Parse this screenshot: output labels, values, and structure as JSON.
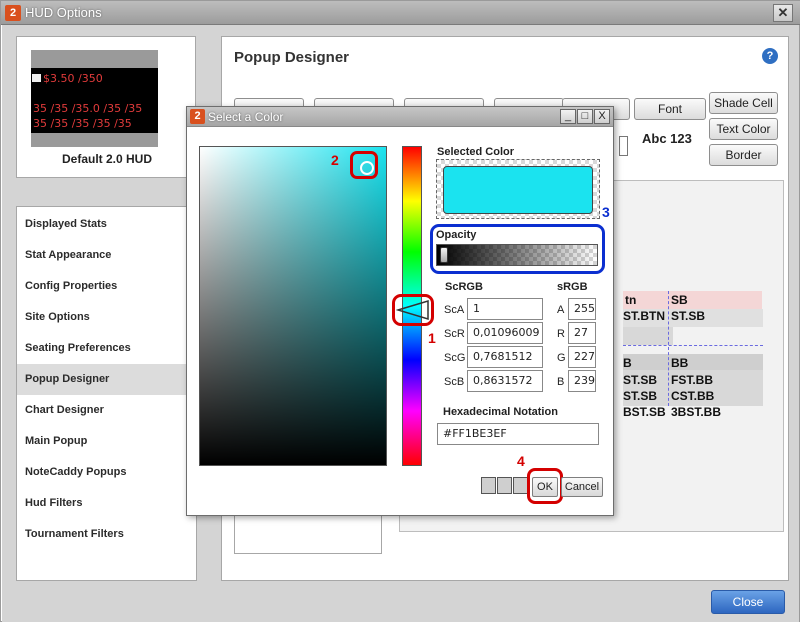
{
  "window": {
    "title": "HUD Options",
    "close_glyph": "✕"
  },
  "preview": {
    "hud_lines": [
      "$3.50 /350",
      "35 /35 /35.0 /35 /35",
      "35 /35 /35 /35 /35"
    ],
    "label": "Default 2.0 HUD"
  },
  "sidebar": {
    "items": [
      {
        "label": "Displayed Stats"
      },
      {
        "label": "Stat Appearance"
      },
      {
        "label": "Config Properties"
      },
      {
        "label": "Site Options"
      },
      {
        "label": "Seating Preferences"
      },
      {
        "label": "Popup Designer"
      },
      {
        "label": "Chart Designer"
      },
      {
        "label": "Main Popup"
      },
      {
        "label": "NoteCaddy Popups"
      },
      {
        "label": "Hud Filters"
      },
      {
        "label": "Tournament Filters"
      }
    ],
    "active_index": 5
  },
  "designer": {
    "title": "Popup Designer",
    "help_glyph": "?",
    "buttons": {
      "font": "Font",
      "shade_cell": "Shade Cell",
      "text_color": "Text Color",
      "border": "Border"
    },
    "sample_text": "Abc 123",
    "grid_cells": [
      [
        "tn",
        "SB"
      ],
      [
        "ST.BTN",
        "ST.SB"
      ],
      [
        "B",
        "BB"
      ],
      [
        "ST.SB",
        "FST.BB"
      ],
      [
        "ST.SB",
        "CST.BB"
      ],
      [
        "BST.SB",
        "3BST.BB"
      ]
    ]
  },
  "close_button": "Close",
  "dialog": {
    "title": "Select a Color",
    "window_buttons": [
      "_",
      "□",
      "X"
    ],
    "selected_color_label": "Selected Color",
    "selected_color": "#1BE3EF",
    "opacity_label": "Opacity",
    "opacity_value": 1,
    "scrgb": {
      "label": "ScRGB",
      "rows": [
        {
          "label": "ScA",
          "value": "1"
        },
        {
          "label": "ScR",
          "value": "0,01096009"
        },
        {
          "label": "ScG",
          "value": "0,7681512"
        },
        {
          "label": "ScB",
          "value": "0,8631572"
        }
      ]
    },
    "srgb": {
      "label": "sRGB",
      "rows": [
        {
          "label": "A",
          "value": "255"
        },
        {
          "label": "R",
          "value": "27"
        },
        {
          "label": "G",
          "value": "227"
        },
        {
          "label": "B",
          "value": "239"
        }
      ]
    },
    "hex_label": "Hexadecimal Notation",
    "hex_value": "#FF1BE3EF",
    "ok": "OK",
    "cancel": "Cancel",
    "annotations": [
      "1",
      "2",
      "3",
      "4"
    ]
  },
  "colors": {
    "accent_red": "#D40000",
    "accent_blue": "#0B2FD0",
    "selected": "#1BE3EF"
  }
}
